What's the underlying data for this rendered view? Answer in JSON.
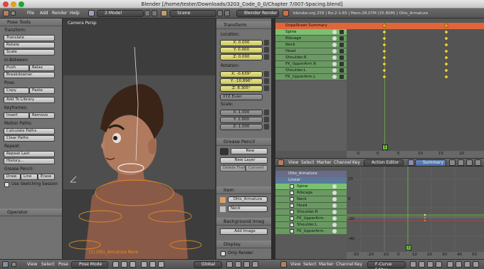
{
  "window": {
    "title": "Blender [/home/tester/Downloads/3203_Code_0_0/Chapter 7/007-Spacing.blend]"
  },
  "info": {
    "menus": [
      "File",
      "Add",
      "Render",
      "Help"
    ],
    "layout": "2-Model",
    "scene": "Scene",
    "engine": "Blender Render",
    "stats": "blender.org 259 | Bo:2-1:65 | Mem:28.07M (25.80M) | Otto_Armature"
  },
  "shelf": {
    "title": "Pose Tools",
    "transform_label": "Transform:",
    "translate": "Translate",
    "rotate": "Rotate",
    "scale": "Scale",
    "inbetween_label": "In-Between:",
    "push": "Push",
    "relax": "Relax",
    "breakdowner": "Breakdowner",
    "pose_label": "Pose:",
    "copy": "Copy",
    "paste": "Paste",
    "add_library": "Add To Library",
    "keyframes_label": "Keyframes:",
    "insert": "Insert",
    "remove": "Remove",
    "motion_label": "Motion Paths:",
    "calc_paths": "Calculate Paths",
    "clear_paths": "Clear Paths",
    "repeat_label": "Repeat:",
    "repeat_last": "Repeat Last",
    "history": "History...",
    "gp_label": "Grease Pencil:",
    "draw": "Draw",
    "line": "Line",
    "erase": "Erase",
    "sketching": "Use Sketching Session",
    "operator": "Operator"
  },
  "viewport": {
    "label": "Camera Persp",
    "selected": "(1) Otto_Armature Neck"
  },
  "props": {
    "transform": "Transform",
    "location": "Location:",
    "loc": [
      "X: 0.000",
      "Y: 0.000",
      "Z: 0.000"
    ],
    "rotation": "Rotation:",
    "rot": [
      "X: -0.639°",
      "Y: -10.896°",
      "Z: 8.305°"
    ],
    "euler": "XYZ Euler",
    "scale": "Scale:",
    "scl": [
      "X: 1.000",
      "Y: 1.000",
      "Z: 1.000"
    ],
    "grease": "Grease Pencil",
    "new": "New",
    "new_layer": "New Layer",
    "delete_frame": "Delete Frame",
    "convert": "Convert",
    "item": "Item",
    "object": "Otto_Armature",
    "bone": "Neck",
    "bg_image": "Background Imag",
    "add_image": "Add Image",
    "display": "Display",
    "only_render": "Only Render"
  },
  "dopesheet": {
    "summary": "DopeSheet Summary",
    "channels": [
      "Spine",
      "Ribcage",
      "Neck",
      "Head",
      "Shoulder.R",
      "FK_UpperArm.R",
      "Shoulder.L",
      "FK_UpperArm.L"
    ],
    "ticks": [
      "-5",
      "0",
      "5",
      "10",
      "15",
      "20"
    ],
    "frame": "1",
    "menus": [
      "View",
      "Select",
      "Marker",
      "Channel",
      "Key"
    ],
    "mode": "Action Editor",
    "action": "Summary"
  },
  "graph": {
    "object": "Otto_Armature",
    "action": "Linear",
    "channels": [
      "Spine",
      "Ribcage",
      "Neck",
      "Head",
      "Shoulder.R",
      "FK_UpperArm.",
      "Shoulder.L",
      "FK_UpperArm."
    ],
    "xticks": [
      "-30",
      "-20",
      "-10",
      "0",
      "10",
      "20",
      "30",
      "40",
      "50"
    ],
    "yticks": [
      "20",
      "0",
      "-20",
      "-40"
    ],
    "frame": "1",
    "menus": [
      "View",
      "Select",
      "Marker",
      "Channel",
      "Key"
    ],
    "mode": "F-Curve Editor"
  },
  "bottom": {
    "menus": [
      "View",
      "Select",
      "Pose"
    ],
    "mode": "Pose Mode",
    "orient": "Global"
  }
}
